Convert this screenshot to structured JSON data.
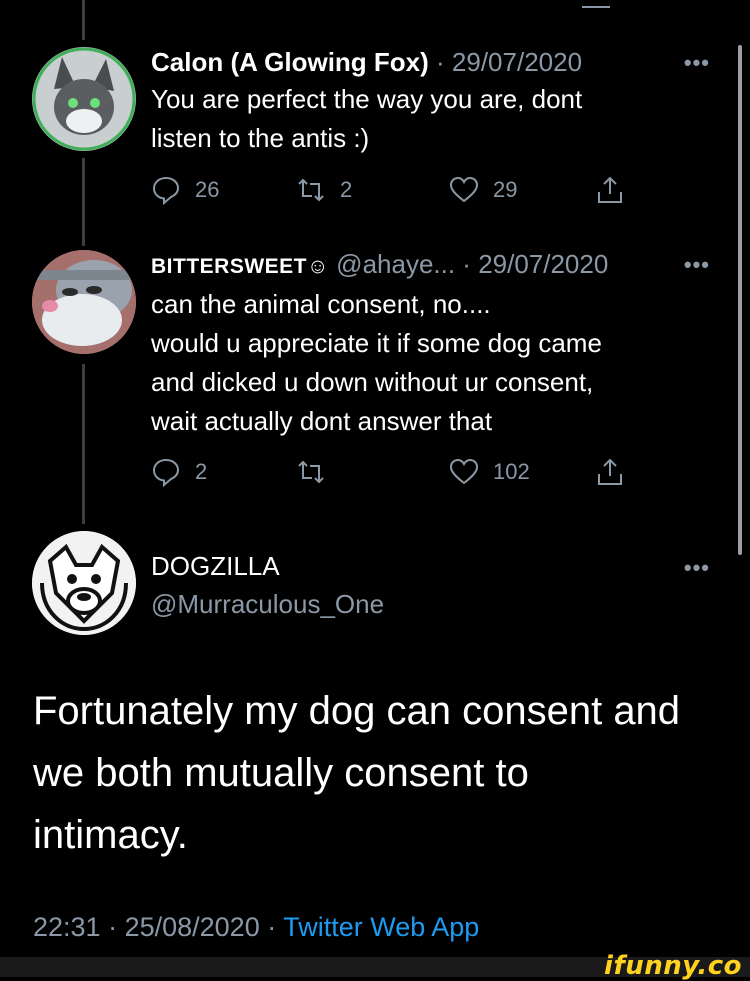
{
  "tweets": [
    {
      "name": "Calon (A Glowing Fox)",
      "handle": "",
      "date_sep": " · ",
      "date": "29/07/2020",
      "text_lines": [
        "You are perfect the way you are, dont",
        "listen to the antis :)"
      ],
      "replies": "26",
      "retweets": "2",
      "likes": "29",
      "avatar_icon": "fox-avatar"
    },
    {
      "name": "BITTERSWEET☺",
      "handle": "@ahaye...",
      "date_sep": " · ",
      "date": "29/07/2020",
      "text_lines": [
        "can the animal consent, no....",
        "would u appreciate it if some dog came",
        "and dicked u down without ur consent,",
        "wait actually dont answer that"
      ],
      "replies": "2",
      "retweets": "",
      "likes": "102",
      "avatar_icon": "bugs-bunny-avatar"
    }
  ],
  "main_tweet": {
    "name": "DOGZILLA",
    "handle": "@Murraculous_One",
    "text_lines": [
      "Fortunately my dog can consent and",
      "we both mutually consent to",
      "intimacy."
    ],
    "time": "22:31",
    "sep1": " · ",
    "date": "25/08/2020",
    "sep2": " · ",
    "source": "Twitter Web App",
    "avatar_icon": "dog-logo-avatar"
  },
  "more_label": "•••",
  "watermark": "ifunny.co",
  "colors": {
    "background": "#000000",
    "muted": "#8b98a5",
    "link": "#1d9bf0",
    "watermark": "#ffd21f"
  }
}
